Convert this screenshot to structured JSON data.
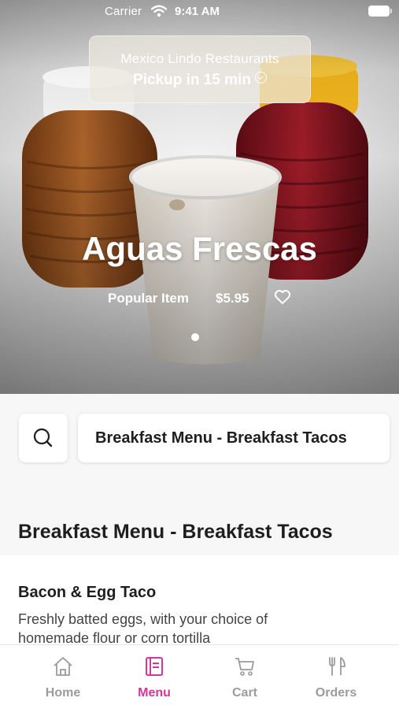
{
  "status_bar": {
    "carrier": "Carrier",
    "time": "9:41 AM"
  },
  "header": {
    "restaurant": "Mexico Lindo Restaurants",
    "pickup": "Pickup in 15 min"
  },
  "featured": {
    "title": "Aguas Frescas",
    "tag": "Popular Item",
    "price": "$5.95",
    "slide_count": 1,
    "active_slide": 1
  },
  "category": {
    "selected": "Breakfast Menu - Breakfast Tacos"
  },
  "section": {
    "heading": "Breakfast Menu - Breakfast Tacos"
  },
  "menu_items": [
    {
      "name": "Bacon & Egg Taco",
      "description_line1": "Freshly batted eggs, with your choice of",
      "description_line2": "homemade flour or corn tortilla"
    }
  ],
  "tabs": [
    {
      "label": "Home",
      "icon": "home-icon",
      "active": false
    },
    {
      "label": "Menu",
      "icon": "menu-book-icon",
      "active": true
    },
    {
      "label": "Cart",
      "icon": "cart-icon",
      "active": false
    },
    {
      "label": "Orders",
      "icon": "fork-knife-icon",
      "active": false
    }
  ],
  "colors": {
    "accent": "#d6359c",
    "inactive_tab": "#9b9b9b",
    "text": "#1e1e1e"
  }
}
